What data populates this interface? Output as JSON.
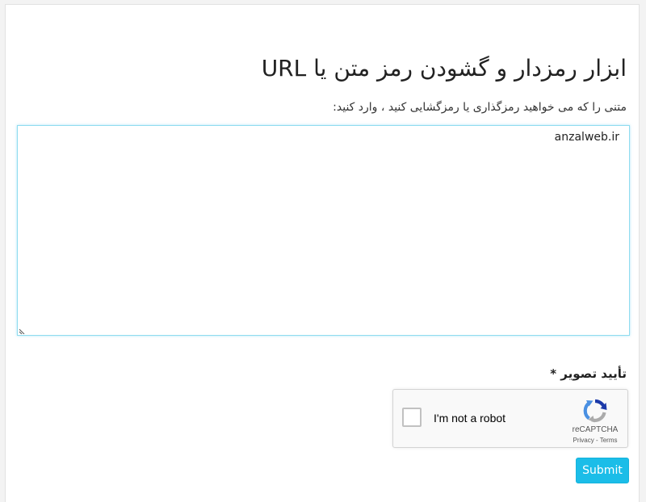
{
  "page": {
    "title": "ابزار رمزدار و گشودن رمز متن یا URL",
    "instruction": "متنی را که می خواهید رمزگذاری یا رمزگشایی کنید ، وارد کنید:"
  },
  "input": {
    "value": "anzalweb.ir",
    "placeholder": ""
  },
  "captcha": {
    "label": "تأیید تصویر *",
    "checkbox_text": "I'm not a robot",
    "brand": "reCAPTCHA",
    "privacy": "Privacy",
    "separator": " - ",
    "terms": "Terms"
  },
  "actions": {
    "submit_label": "Submit"
  },
  "colors": {
    "accent": "#1bbde8",
    "textarea_border": "#8fdcef",
    "recaptcha_blue": "#4a90e2",
    "recaptcha_dark_blue": "#1c3aa9",
    "recaptcha_gray": "#ababab"
  },
  "icons": {
    "recaptcha": "recaptcha-logo-icon",
    "resize": "resize-grip-icon"
  }
}
